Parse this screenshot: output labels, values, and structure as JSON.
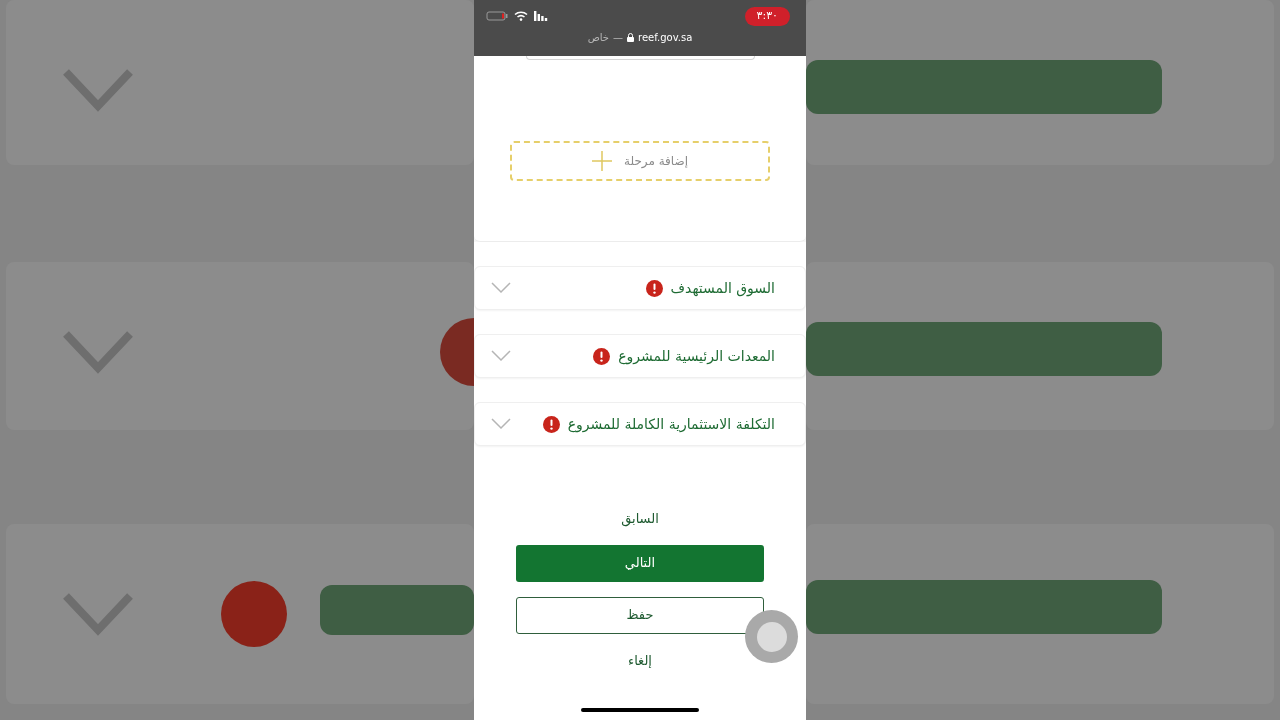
{
  "status_bar": {
    "time": "٣:٣٠",
    "address": {
      "label": "خاص",
      "separator": "—",
      "url": "reef.gov.sa"
    }
  },
  "add_stage": {
    "label": "إضافة مرحلة"
  },
  "sections": [
    {
      "title": "السوق المستهدف",
      "has_error": true,
      "expanded": false
    },
    {
      "title": "المعدات الرئيسية للمشروع",
      "has_error": true,
      "expanded": false
    },
    {
      "title": "التكلفة الاستثمارية الكاملة للمشروع",
      "has_error": true,
      "expanded": false
    }
  ],
  "actions": [
    {
      "label": "السابق",
      "kind": "link"
    },
    {
      "label": "التالي",
      "kind": "primary"
    },
    {
      "label": "حفظ",
      "kind": "outline"
    },
    {
      "label": "إلغاء",
      "kind": "link"
    }
  ]
}
